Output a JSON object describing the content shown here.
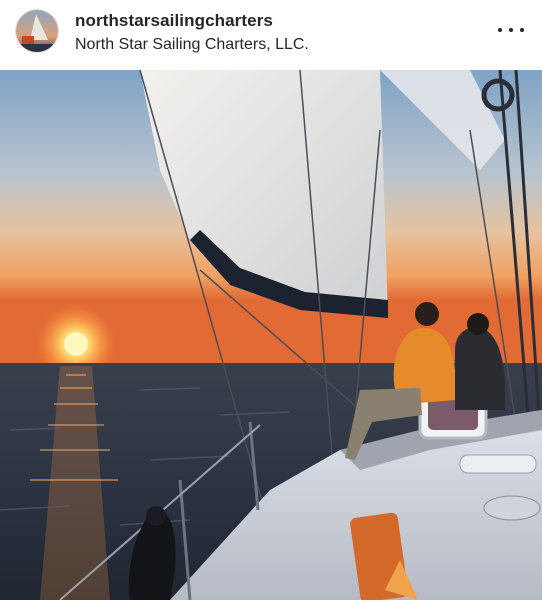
{
  "post": {
    "username": "northstarsailingcharters",
    "location": "North Star Sailing Charters, LLC.",
    "more_icon": "more-horizontal-icon",
    "photo_description_icon": "sailboat-sunset-photo"
  },
  "colors": {
    "text": "#262626",
    "sky_top": "#7fa3c4",
    "horizon": "#f08a3c",
    "sun": "#ffe58a",
    "water": "#2a3442"
  }
}
